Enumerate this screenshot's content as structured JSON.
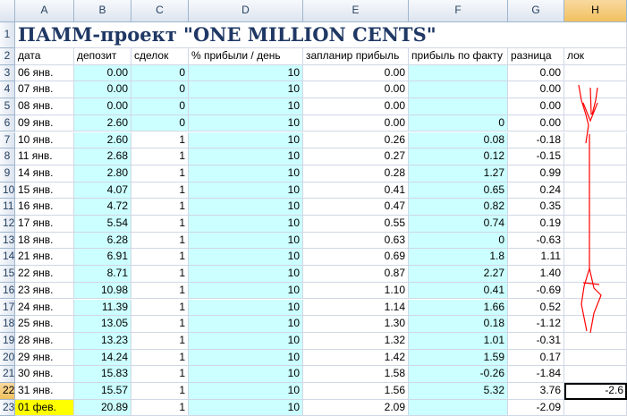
{
  "columns": [
    "A",
    "B",
    "C",
    "D",
    "E",
    "F",
    "G",
    "H"
  ],
  "title": "ПАММ-проект \"ONE MILLION CENTS\"",
  "headers": [
    "дата",
    "депозит",
    "сделок",
    "% прибыли / день",
    "запланир прибыль",
    "прибыль по факту",
    "разница",
    "лок"
  ],
  "rows": [
    {
      "n": "3",
      "a": "06 янв.",
      "b": "0.00",
      "c": "0",
      "d": "10",
      "e": "0.00",
      "f": "",
      "g": "0.00",
      "h": ""
    },
    {
      "n": "4",
      "a": "07 янв.",
      "b": "0.00",
      "c": "0",
      "d": "10",
      "e": "0.00",
      "f": "",
      "g": "0.00",
      "h": ""
    },
    {
      "n": "5",
      "a": "08 янв.",
      "b": "0.00",
      "c": "0",
      "d": "10",
      "e": "0.00",
      "f": "",
      "g": "0.00",
      "h": ""
    },
    {
      "n": "6",
      "a": "09 янв.",
      "b": "2.60",
      "c": "0",
      "d": "10",
      "e": "0.00",
      "f": "0",
      "g": "0.00",
      "h": ""
    },
    {
      "n": "7",
      "a": "10 янв.",
      "b": "2.60",
      "c": "1",
      "d": "10",
      "e": "0.26",
      "f": "0.08",
      "g": "-0.18",
      "h": ""
    },
    {
      "n": "8",
      "a": "11 янв.",
      "b": "2.68",
      "c": "1",
      "d": "10",
      "e": "0.27",
      "f": "0.12",
      "g": "-0.15",
      "h": ""
    },
    {
      "n": "9",
      "a": "14 янв.",
      "b": "2.80",
      "c": "1",
      "d": "10",
      "e": "0.28",
      "f": "1.27",
      "g": "0.99",
      "h": ""
    },
    {
      "n": "10",
      "a": "15 янв.",
      "b": "4.07",
      "c": "1",
      "d": "10",
      "e": "0.41",
      "f": "0.65",
      "g": "0.24",
      "h": ""
    },
    {
      "n": "11",
      "a": "16 янв.",
      "b": "4.72",
      "c": "1",
      "d": "10",
      "e": "0.47",
      "f": "0.82",
      "g": "0.35",
      "h": ""
    },
    {
      "n": "12",
      "a": "17 янв.",
      "b": "5.54",
      "c": "1",
      "d": "10",
      "e": "0.55",
      "f": "0.74",
      "g": "0.19",
      "h": ""
    },
    {
      "n": "13",
      "a": "18 янв.",
      "b": "6.28",
      "c": "1",
      "d": "10",
      "e": "0.63",
      "f": "0",
      "g": "-0.63",
      "h": ""
    },
    {
      "n": "14",
      "a": "21 янв.",
      "b": "6.91",
      "c": "1",
      "d": "10",
      "e": "0.69",
      "f": "1.8",
      "g": "1.11",
      "h": ""
    },
    {
      "n": "15",
      "a": "22 янв.",
      "b": "8.71",
      "c": "1",
      "d": "10",
      "e": "0.87",
      "f": "2.27",
      "g": "1.40",
      "h": ""
    },
    {
      "n": "16",
      "a": "23 янв.",
      "b": "10.98",
      "c": "1",
      "d": "10",
      "e": "1.10",
      "f": "0.41",
      "g": "-0.69",
      "h": ""
    },
    {
      "n": "17",
      "a": "24 янв.",
      "b": "11.39",
      "c": "1",
      "d": "10",
      "e": "1.14",
      "f": "1.66",
      "g": "0.52",
      "h": ""
    },
    {
      "n": "18",
      "a": "25 янв.",
      "b": "13.05",
      "c": "1",
      "d": "10",
      "e": "1.30",
      "f": "0.18",
      "g": "-1.12",
      "h": ""
    },
    {
      "n": "19",
      "a": "28 янв.",
      "b": "13.23",
      "c": "1",
      "d": "10",
      "e": "1.32",
      "f": "1.01",
      "g": "-0.31",
      "h": ""
    },
    {
      "n": "20",
      "a": "29 янв.",
      "b": "14.24",
      "c": "1",
      "d": "10",
      "e": "1.42",
      "f": "1.59",
      "g": "0.17",
      "h": ""
    },
    {
      "n": "21",
      "a": "30 янв.",
      "b": "15.83",
      "c": "1",
      "d": "10",
      "e": "1.58",
      "f": "-0.26",
      "g": "-1.84",
      "h": ""
    },
    {
      "n": "22",
      "a": "31 янв.",
      "b": "15.57",
      "c": "1",
      "d": "10",
      "e": "1.56",
      "f": "5.32",
      "g": "3.76",
      "h": "-2.6"
    },
    {
      "n": "23",
      "a": "01 фев.",
      "b": "20.89",
      "c": "1",
      "d": "10",
      "e": "2.09",
      "f": "",
      "g": "-2.09",
      "h": ""
    }
  ],
  "colors": {
    "cyan": "#ccffff",
    "yellow": "#ffff00",
    "title": "#1f3864",
    "annotation": "#ff0000"
  }
}
